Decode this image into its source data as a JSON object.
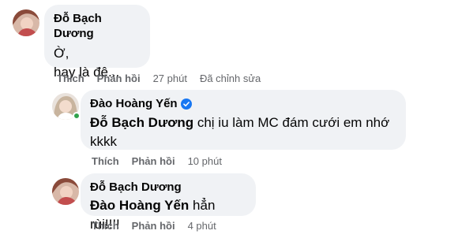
{
  "comments": [
    {
      "author": "Đỗ Bạch Dương",
      "lines": [
        "Ờ,",
        "hay là đê..."
      ],
      "actions": {
        "like": "Thích",
        "reply": "Phản hồi",
        "time": "27 phút",
        "edited": "Đã chỉnh sửa"
      }
    },
    {
      "author": "Đào Hoàng Yến",
      "verified": true,
      "mention": "Đỗ Bạch Dương",
      "text": " chị iu làm MC đám cưới em nhớ",
      "text2": "kkkk",
      "actions": {
        "like": "Thích",
        "reply": "Phản hồi",
        "time": "10 phút"
      }
    },
    {
      "author": "Đỗ Bạch Dương",
      "mention": "Đào Hoàng Yến",
      "text": " hẳn rùi!!!!",
      "actions": {
        "like": "Thích",
        "reply": "Phản hồi",
        "time": "4 phút"
      }
    }
  ],
  "colors": {
    "bubble": "#f0f2f5",
    "meta": "#65676b",
    "verified": "#1877f2",
    "online": "#31a24c"
  }
}
